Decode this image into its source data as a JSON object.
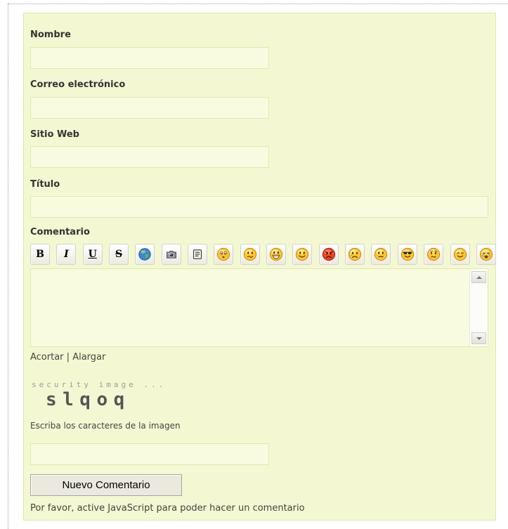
{
  "colors": {
    "panel_bg": "#f4f8d2",
    "panel_border": "#dce7a3",
    "field_bg": "#f8fbdf",
    "field_border": "#e0eaa9",
    "text": "#444444",
    "label": "#333333"
  },
  "form": {
    "name": {
      "label": "Nombre",
      "value": ""
    },
    "email": {
      "label": "Correo electrónico",
      "value": ""
    },
    "website": {
      "label": "Sitio Web",
      "value": ""
    },
    "title": {
      "label": "Título",
      "value": ""
    },
    "comment": {
      "label": "Comentario",
      "value": ""
    },
    "toolbar": [
      {
        "icon": "bold-icon",
        "glyph": "B"
      },
      {
        "icon": "italic-icon",
        "glyph": "I"
      },
      {
        "icon": "underline-icon",
        "glyph": "U"
      },
      {
        "icon": "strikethrough-icon",
        "glyph": "S"
      },
      {
        "icon": "globe-icon"
      },
      {
        "icon": "camera-icon"
      },
      {
        "icon": "note-icon"
      },
      {
        "icon": "surprised-smiley-icon"
      },
      {
        "icon": "confused-smiley-icon"
      },
      {
        "icon": "grin-smiley-icon"
      },
      {
        "icon": "happy-smiley-icon"
      },
      {
        "icon": "angry-smiley-icon"
      },
      {
        "icon": "sad-smiley-icon"
      },
      {
        "icon": "neutral-smiley-icon"
      },
      {
        "icon": "cool-smiley-icon"
      },
      {
        "icon": "worried-smiley-icon"
      },
      {
        "icon": "smile-smiley-icon"
      },
      {
        "icon": "crying-smiley-icon"
      }
    ],
    "resize": {
      "shorten": "Acortar",
      "separator": "|",
      "lengthen": "Alargar"
    },
    "captcha": {
      "caption": "security image ...",
      "text": "slqoq",
      "instructions": "Escriba los caracteres de la imagen",
      "value": ""
    },
    "submit_label": "Nuevo Comentario",
    "notice": "Por favor, active JavaScript para poder hacer un comentario"
  }
}
